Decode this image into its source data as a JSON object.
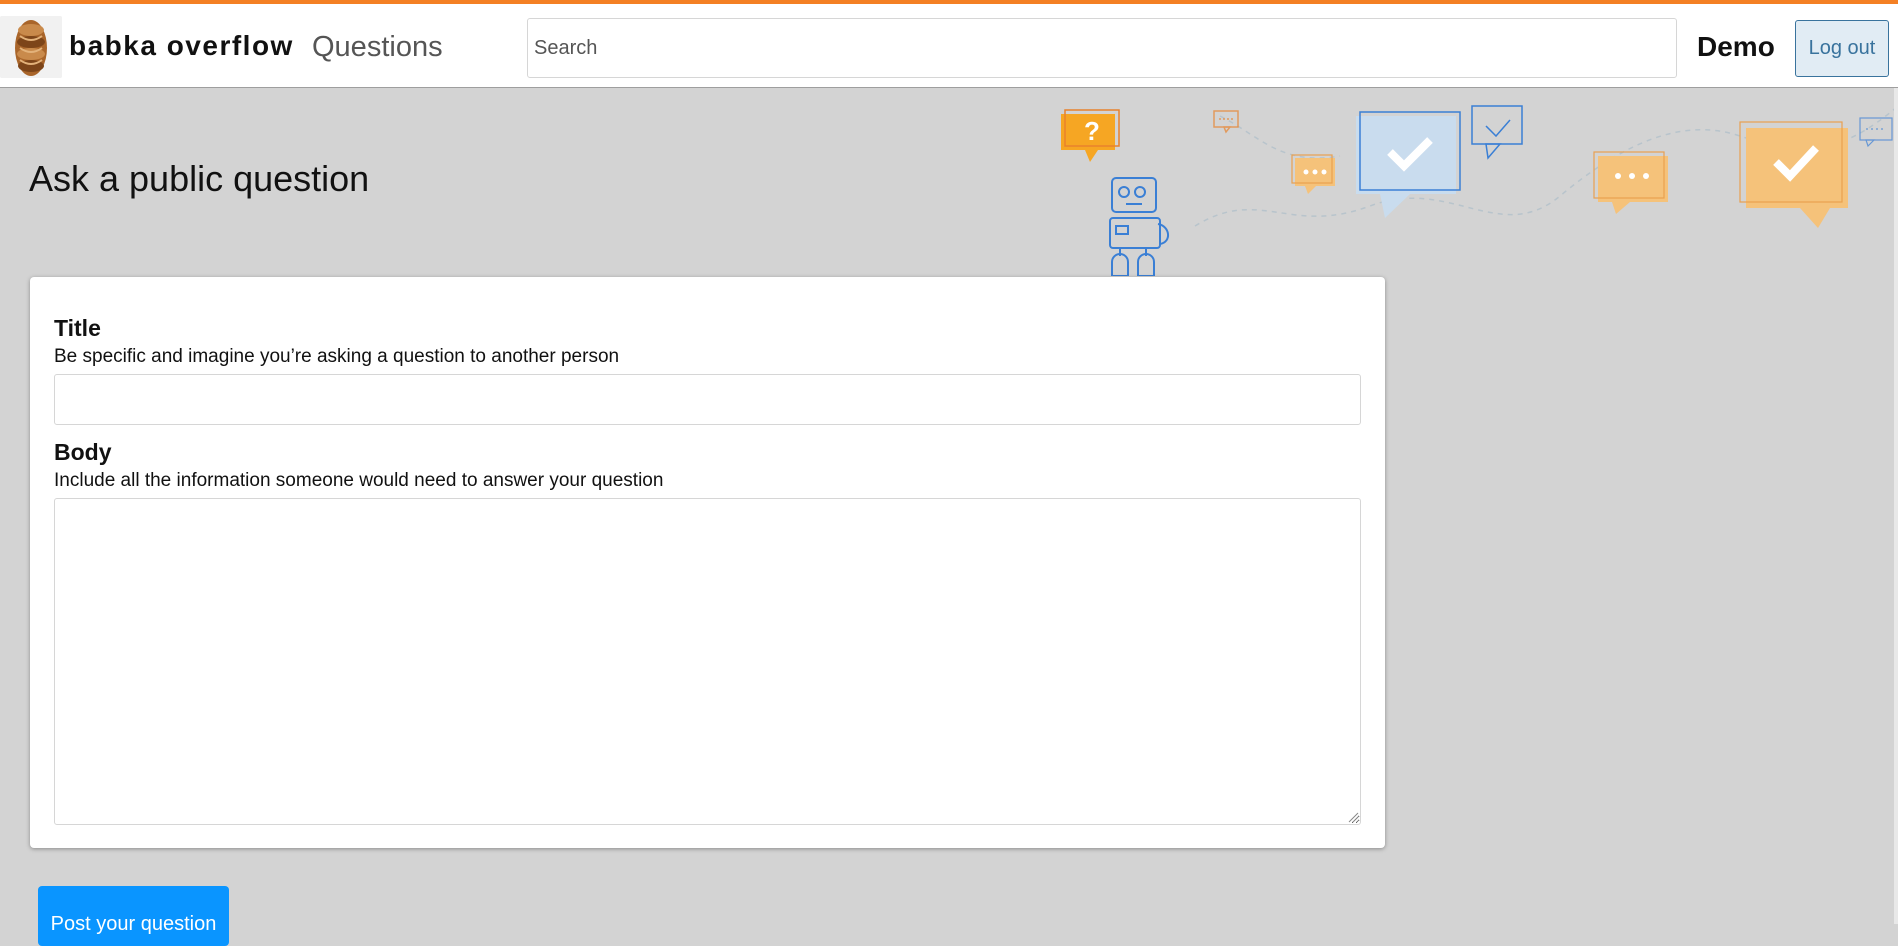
{
  "header": {
    "brand": "babka overflow",
    "logo_icon": "babka-logo-icon",
    "nav_questions": "Questions",
    "search_placeholder": "Search",
    "search_value": "",
    "user_name": "Demo",
    "logout_label": "Log out",
    "accent_color": "#f48024"
  },
  "main": {
    "heading": "Ask a public question",
    "illustration": "robot-chat-bubbles-illustration"
  },
  "form": {
    "title_label": "Title",
    "title_hint": "Be specific and imagine you’re asking a question to another person",
    "title_value": "",
    "body_label": "Body",
    "body_hint": "Include all the information someone would need to answer your question",
    "body_value": "",
    "submit_label": "Post your question",
    "submit_color": "#0a95ff"
  }
}
